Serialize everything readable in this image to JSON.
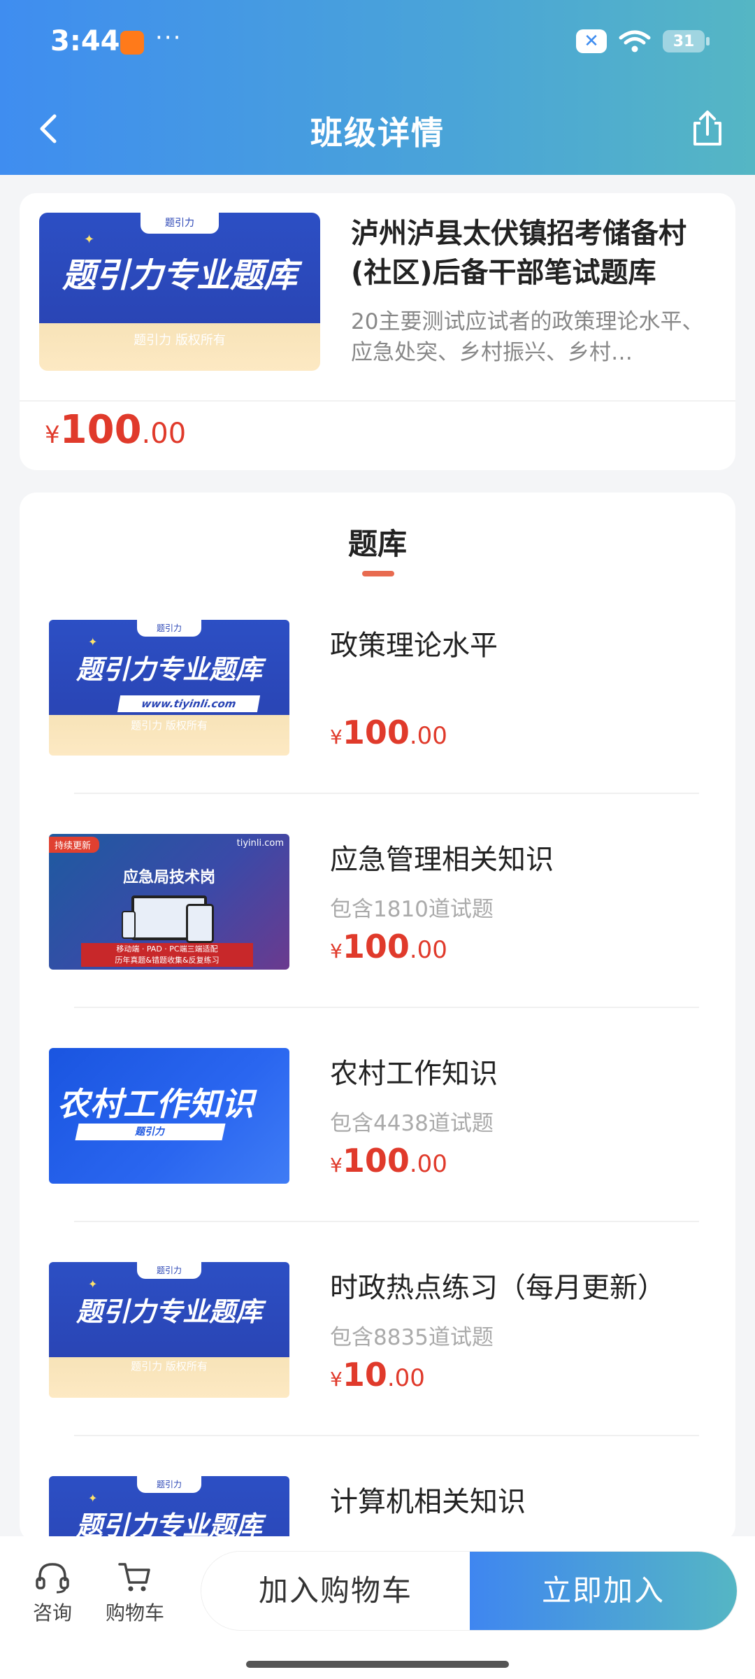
{
  "status_bar": {
    "time": "3:44",
    "dots": "···",
    "battery": "31"
  },
  "header": {
    "title": "班级详情"
  },
  "product": {
    "title": "泸州泸县太伏镇招考储备村(社区)后备干部笔试题库",
    "description": "20主要测试应试者的政策理论水平、应急处突、乡村振兴、乡村…",
    "price": {
      "symbol": "¥",
      "integer": "100",
      "decimal": ".00"
    },
    "banner": {
      "title": "题引力专业题库",
      "subtitle": "题引力 版权所有",
      "logo": "题引力"
    }
  },
  "bank": {
    "section_title": "题库",
    "items": [
      {
        "name": "政策理论水平",
        "count": "",
        "price": {
          "symbol": "¥",
          "integer": "100",
          "decimal": ".00"
        },
        "banner": {
          "title": "题引力专业题库",
          "url": "www.tiyinli.com",
          "subtitle": "题引力 版权所有",
          "logo": "题引力"
        }
      },
      {
        "name": "应急管理相关知识",
        "count": "包含1810道试题",
        "price": {
          "symbol": "¥",
          "integer": "100",
          "decimal": ".00"
        },
        "thumb": {
          "tag": "持续更新",
          "brand": "tiyinli.com",
          "title": "应急局技术岗",
          "bar_line1": "移动端 · PAD · PC端三端适配",
          "bar_line2": "历年真题&错题收集&反复练习"
        }
      },
      {
        "name": "农村工作知识",
        "count": "包含4438道试题",
        "price": {
          "symbol": "¥",
          "integer": "100",
          "decimal": ".00"
        },
        "thumb": {
          "title": "农村工作知识",
          "bar": "题引力"
        }
      },
      {
        "name": "时政热点练习（每月更新）",
        "count": "包含8835道试题",
        "price": {
          "symbol": "¥",
          "integer": "10",
          "decimal": ".00"
        },
        "banner": {
          "title": "题引力专业题库",
          "subtitle": "题引力 版权所有",
          "logo": "题引力"
        }
      },
      {
        "name": "计算机相关知识",
        "banner": {
          "title": "题引力专业题库",
          "logo": "题引力"
        }
      }
    ]
  },
  "bottom_bar": {
    "consult_label": "咨询",
    "cart_label": "购物车",
    "add_cart_label": "加入购物车",
    "join_label": "立即加入"
  },
  "colors": {
    "accent": "#3f8df0",
    "price": "#e03a2b",
    "underline": "#e86b50"
  },
  "icons": [
    "back-arrow-icon",
    "share-icon",
    "headset-icon",
    "cart-icon",
    "wifi-icon",
    "battery-icon"
  ]
}
